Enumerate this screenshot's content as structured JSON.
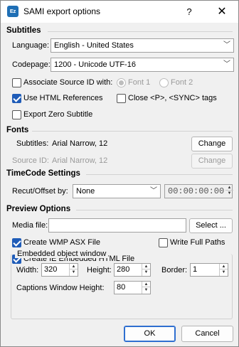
{
  "window": {
    "title": "SAMI export options",
    "icon_text": "Ez",
    "help_glyph": "?",
    "close_glyph": "✕"
  },
  "subtitles": {
    "heading": "Subtitles",
    "language_label": "Language:",
    "language_value": "English - United States",
    "codepage_label": "Codepage:",
    "codepage_value": "1200 - Unicode UTF-16",
    "assoc_source_id_label": "Associate Source ID with:",
    "assoc_source_id_checked": false,
    "font1_label": "Font 1",
    "font2_label": "Font 2",
    "font_selected": "Font 1",
    "use_html_refs_label": "Use HTML References",
    "use_html_refs_checked": true,
    "close_tags_label": "Close <P>, <SYNC> tags",
    "close_tags_checked": false,
    "export_zero_label": "Export Zero Subtitle",
    "export_zero_checked": false
  },
  "fonts": {
    "heading": "Fonts",
    "subtitles_label": "Subtitles:",
    "subtitles_value": "Arial Narrow, 12",
    "source_id_label": "Source ID:",
    "source_id_value": "Arial Narrow, 12",
    "change_label": "Change",
    "change2_label": "Change"
  },
  "timecode": {
    "heading": "TimeCode Settings",
    "recut_label": "Recut/Offset by:",
    "recut_value": "None",
    "offset_value": "00:00:00:00"
  },
  "preview": {
    "heading": "Preview Options",
    "media_file_label": "Media file:",
    "media_file_value": "",
    "select_label": "Select ...",
    "create_wmp_label": "Create WMP ASX File",
    "create_wmp_checked": true,
    "write_full_paths_label": "Write Full Paths",
    "write_full_paths_checked": false,
    "create_ie_label": "Create IE Embedded HTML File",
    "create_ie_checked": true,
    "embedded_group_label": "Embedded object window",
    "width_label": "Width:",
    "width_value": "320",
    "height_label": "Height:",
    "height_value": "280",
    "border_label": "Border:",
    "border_value": "1",
    "captions_height_label": "Captions Window Height:",
    "captions_height_value": "80"
  },
  "buttons": {
    "ok": "OK",
    "cancel": "Cancel"
  },
  "colors": {
    "accent": "#1f5cb8",
    "default_button_border": "#2f6fd0"
  }
}
